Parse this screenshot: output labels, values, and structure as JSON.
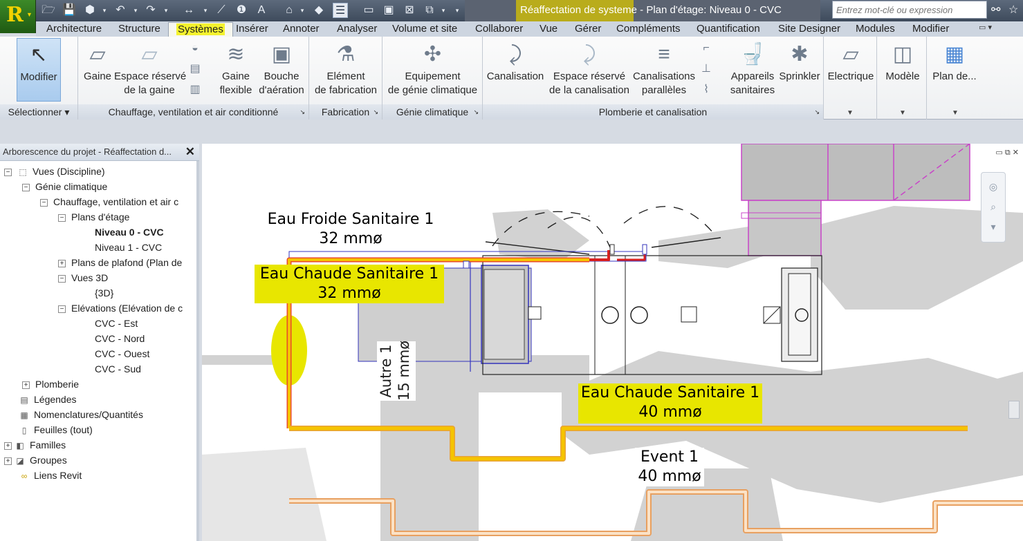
{
  "titlebar": {
    "logo": "R",
    "title_highlight": "Réaffectation de systeme",
    "title_rest": " - Plan d'étage: Niveau 0 - CVC",
    "search_placeholder": "Entrez mot-clé ou expression"
  },
  "tabs": [
    "Architecture",
    "Structure",
    "Systèmes",
    "Insérer",
    "Annoter",
    "Analyser",
    "Volume et site",
    "Collaborer",
    "Vue",
    "Gérer",
    "Compléments",
    "Quantification",
    "Site Designer",
    "Modules",
    "Modifier"
  ],
  "ribbon": {
    "select_panel": {
      "title": "Sélectionner",
      "modify": "Modifier"
    },
    "hvac_panel": {
      "title": "Chauffage, ventilation et air conditionné",
      "duct": "Gaine",
      "duct_space_1": "Espace réservé",
      "duct_space_2": "de la gaine",
      "flex_duct_1": "Gaine",
      "flex_duct_2": "flexible",
      "air_terminal_1": "Bouche",
      "air_terminal_2": "d'aération"
    },
    "fabrication_panel": {
      "title": "Fabrication",
      "part_1": "Elément",
      "part_2": "de fabrication"
    },
    "mechanical_panel": {
      "title": "Génie climatique",
      "equipment_1": "Equipement",
      "equipment_2": "de génie climatique"
    },
    "plumbing_panel": {
      "title": "Plomberie et canalisation",
      "pipe": "Canalisation",
      "pipe_space_1": "Espace réservé",
      "pipe_space_2": "de la canalisation",
      "parallel_1": "Canalisations",
      "parallel_2": "parallèles",
      "fixtures_1": "Appareils",
      "fixtures_2": "sanitaires",
      "sprinkler": "Sprinkler"
    },
    "electrical": "Electrique",
    "model": "Modèle",
    "workplane": "Plan de..."
  },
  "browser": {
    "header": "Arborescence du projet - Réaffectation d...",
    "items": [
      {
        "label": "Vues (Discipline)",
        "toggle": "−",
        "icon": "views-icon"
      },
      {
        "label": "Génie climatique",
        "toggle": "−",
        "icon": ""
      },
      {
        "label": "Chauffage, ventilation et air c",
        "toggle": "−",
        "icon": ""
      },
      {
        "label": "Plans d'étage",
        "toggle": "−",
        "icon": ""
      },
      {
        "label": "Niveau 0 - CVC",
        "toggle": "",
        "icon": ""
      },
      {
        "label": "Niveau 1 - CVC",
        "toggle": "",
        "icon": ""
      },
      {
        "label": "Plans de plafond (Plan de",
        "toggle": "+",
        "icon": ""
      },
      {
        "label": "Vues 3D",
        "toggle": "−",
        "icon": ""
      },
      {
        "label": "{3D}",
        "toggle": "",
        "icon": ""
      },
      {
        "label": "Elévations (Elévation de c",
        "toggle": "−",
        "icon": ""
      },
      {
        "label": "CVC - Est",
        "toggle": "",
        "icon": ""
      },
      {
        "label": "CVC - Nord",
        "toggle": "",
        "icon": ""
      },
      {
        "label": "CVC - Ouest",
        "toggle": "",
        "icon": ""
      },
      {
        "label": "CVC - Sud",
        "toggle": "",
        "icon": ""
      },
      {
        "label": "Plomberie",
        "toggle": "+",
        "icon": ""
      },
      {
        "label": "Légendes",
        "toggle": "",
        "icon": "legend-icon"
      },
      {
        "label": "Nomenclatures/Quantités",
        "toggle": "",
        "icon": "schedule-icon"
      },
      {
        "label": "Feuilles (tout)",
        "toggle": "",
        "icon": "sheet-icon"
      },
      {
        "label": "Familles",
        "toggle": "+",
        "icon": "families-icon"
      },
      {
        "label": "Groupes",
        "toggle": "+",
        "icon": "groups-icon"
      },
      {
        "label": "Liens Revit",
        "toggle": "",
        "icon": "links-icon"
      }
    ]
  },
  "canvas": {
    "tags": {
      "cold_name": "Eau Froide Sanitaire 1",
      "cold_size": "32 mmø",
      "hot_name": "Eau Chaude Sanitaire 1",
      "hot_size": "32 mmø",
      "other_name": "Autre 1",
      "other_size": "15 mmø",
      "hot2_name": "Eau Chaude Sanitaire 1",
      "hot2_size": "40 mmø",
      "vent_name": "Event 1",
      "vent_size": "40 mmø"
    },
    "colors": {
      "highlight": "#e8e600",
      "pipe_selected": "#f5c400",
      "pipe_vent": "#f0a050",
      "magenta": "#d030d0"
    }
  }
}
